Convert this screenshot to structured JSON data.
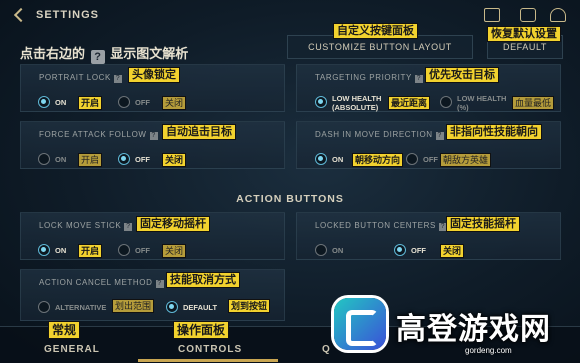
{
  "topbar": {
    "title": "SETTINGS",
    "icons": [
      "back-arrow-icon",
      "clipboard-check-icon",
      "chat-icon",
      "friends-icon"
    ]
  },
  "header": {
    "customize_label": "CUSTOMIZE BUTTON LAYOUT",
    "default_label": "DEFAULT",
    "customize_annotation": "自定义按键面板",
    "default_annotation": "恢复默认设置"
  },
  "hint": {
    "prefix": "点击右边的",
    "icon": "?",
    "suffix": "显示图文解析"
  },
  "settings": {
    "portrait_lock": {
      "label": "PORTRAIT LOCK",
      "annotation": "头像锁定",
      "on": "ON",
      "off": "OFF",
      "on_anno": "开启",
      "off_anno": "关闭",
      "selected": "on"
    },
    "targeting_priority": {
      "label": "TARGETING PRIORITY",
      "annotation": "优先攻击目标",
      "opt1_line1": "LOW HEALTH",
      "opt1_line2": "(ABSOLUTE)",
      "opt1_anno": "最近距离",
      "opt2_line1": "LOW HEALTH",
      "opt2_line2": "(%)",
      "opt2_anno": "血量最低",
      "selected": "opt1"
    },
    "force_attack_follow": {
      "label": "FORCE ATTACK FOLLOW",
      "annotation": "自动追击目标",
      "on": "ON",
      "off": "OFF",
      "on_anno": "开启",
      "off_anno": "关闭",
      "selected": "off"
    },
    "dash_in_move_direction": {
      "label": "DASH IN MOVE DIRECTION",
      "annotation": "非指向性技能朝向",
      "on": "ON",
      "off": "OFF",
      "on_anno": "朝移动方向",
      "off_anno": "朝敌方英雄",
      "selected": "on"
    },
    "section_title": "ACTION BUTTONS",
    "lock_move_stick": {
      "label": "LOCK MOVE STICK",
      "annotation": "固定移动摇杆",
      "on": "ON",
      "off": "OFF",
      "on_anno": "开启",
      "off_anno": "关闭",
      "selected": "on"
    },
    "locked_button_centers": {
      "label": "LOCKED BUTTON CENTERS",
      "annotation": "固定技能摇杆",
      "on": "ON",
      "off": "OFF",
      "off_anno": "关闭",
      "selected": "off"
    },
    "action_cancel_method": {
      "label": "ACTION CANCEL METHOD",
      "annotation": "技能取消方式",
      "opt1": "ALTERNATIVE",
      "opt1_anno": "划出范围",
      "opt2": "DEFAULT",
      "opt2_anno": "划到按钮",
      "selected": "opt2"
    }
  },
  "nav": {
    "general": "GENERAL",
    "general_anno": "常规",
    "controls": "CONTROLS",
    "controls_anno": "操作面板",
    "third_partial": "Q"
  },
  "watermark": {
    "title": "高登游戏网",
    "url": "gordeng.com"
  },
  "colors": {
    "accent_gold": "#c9a652",
    "radio_active": "#7fd6ef",
    "annotation": "#f2d22e"
  }
}
